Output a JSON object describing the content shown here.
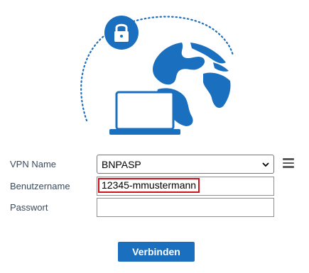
{
  "form": {
    "vpn_name_label": "VPN Name",
    "username_label": "Benutzername",
    "password_label": "Passwort",
    "vpn_name_value": "BNPASP",
    "username_value": "12345-mmustermann",
    "password_value": ""
  },
  "actions": {
    "connect_label": "Verbinden"
  },
  "icons": {
    "illustration": "vpn-globe-laptop-illustration",
    "lock": "lock-icon",
    "menu": "hamburger-menu-icon",
    "dropdown": "chevron-down-icon"
  },
  "colors": {
    "accent": "#1a6fbf",
    "highlight_border": "#d0121b"
  }
}
